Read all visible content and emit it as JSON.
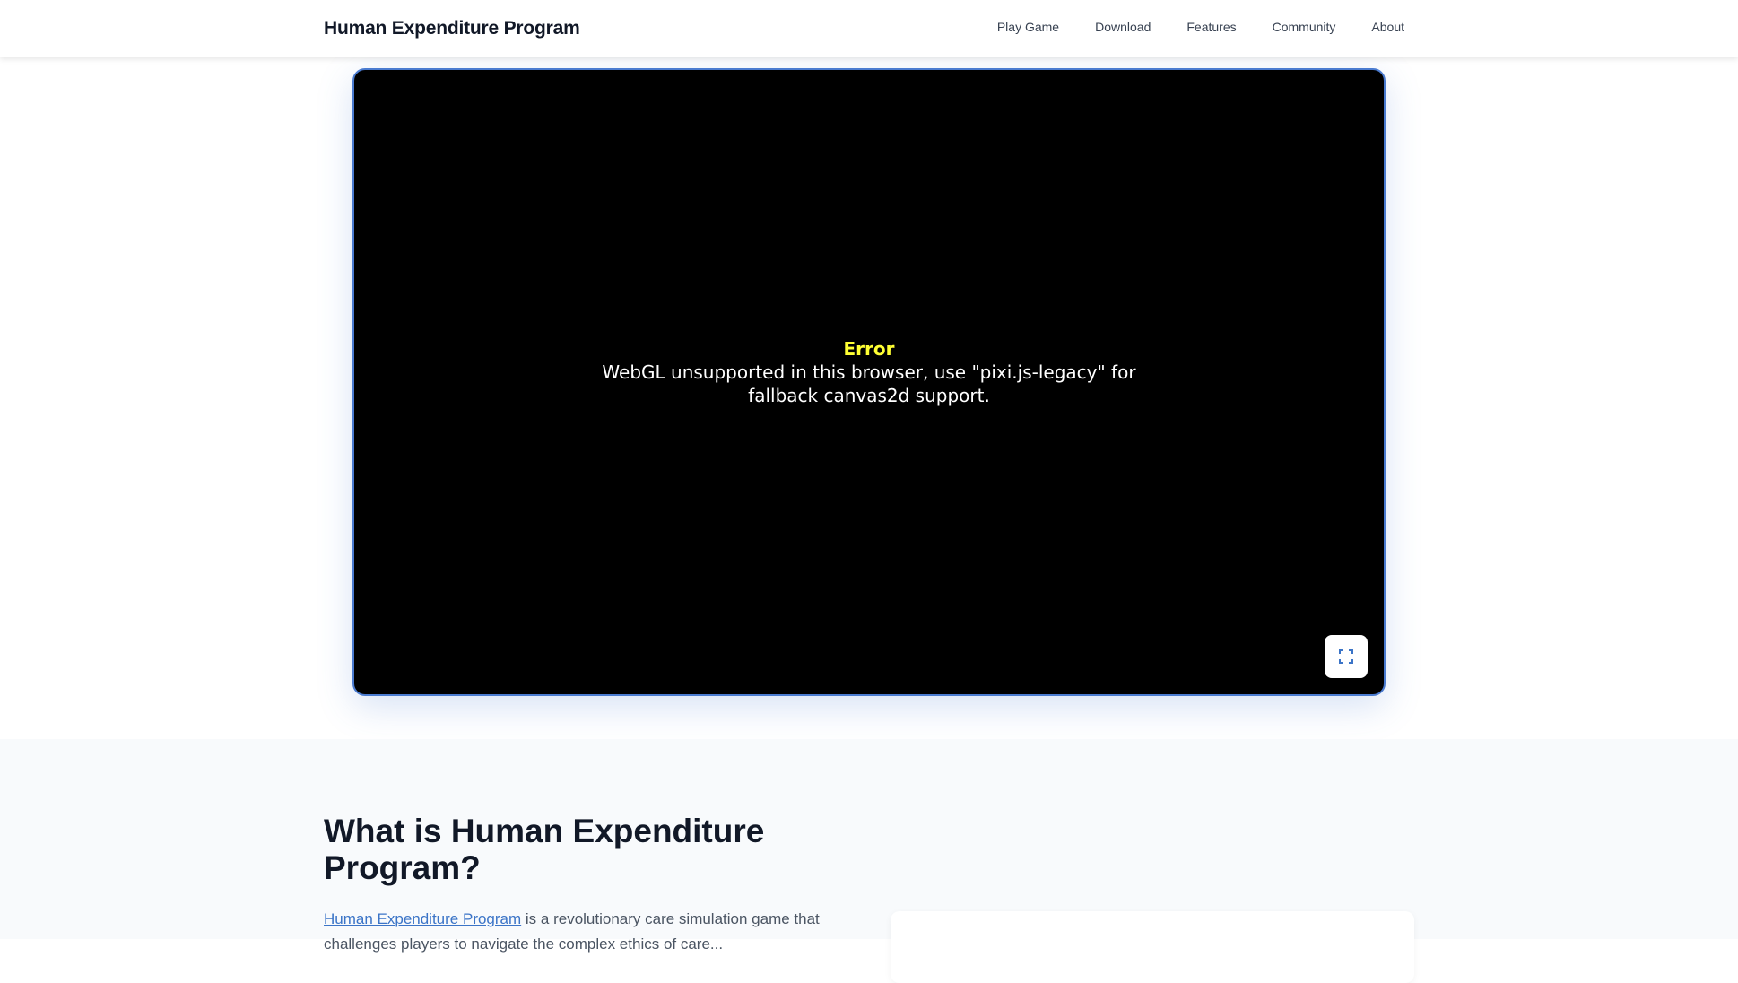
{
  "header": {
    "title": "Human Expenditure Program",
    "nav": [
      "Play Game",
      "Download",
      "Features",
      "Community",
      "About"
    ]
  },
  "game": {
    "error_title": "Error",
    "error_message": "WebGL unsupported in this browser, use \"pixi.js-legacy\" for fallback canvas2d support.",
    "fullscreen_icon": "fullscreen-icon"
  },
  "about": {
    "heading": "What is Human Expenditure Program?",
    "link_text": "Human Expenditure Program",
    "body_text": " is a revolutionary care simulation game that challenges players to navigate the complex ethics of care..."
  },
  "colors": {
    "accent": "#4a7bd0",
    "link": "#3b74c7",
    "error_title": "#ffff33"
  }
}
